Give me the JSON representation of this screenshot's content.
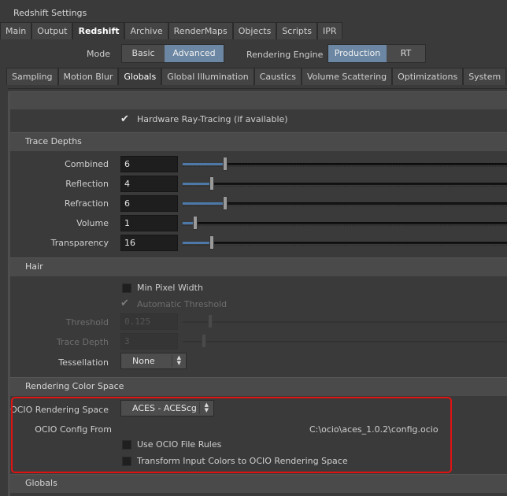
{
  "window": {
    "title": "Redshift Settings"
  },
  "top_tabs": [
    {
      "label": "Main"
    },
    {
      "label": "Output"
    },
    {
      "label": "Redshift"
    },
    {
      "label": "Archive"
    },
    {
      "label": "RenderMaps"
    },
    {
      "label": "Objects"
    },
    {
      "label": "Scripts"
    },
    {
      "label": "IPR"
    }
  ],
  "mode": {
    "label": "Mode",
    "options": [
      "Basic",
      "Advanced"
    ],
    "selected": "Advanced"
  },
  "engine": {
    "label": "Rendering Engine",
    "options": [
      "Production",
      "RT"
    ],
    "selected": "Production"
  },
  "sub_tabs": [
    {
      "label": "Sampling"
    },
    {
      "label": "Motion Blur"
    },
    {
      "label": "Globals"
    },
    {
      "label": "Global Illumination"
    },
    {
      "label": "Caustics"
    },
    {
      "label": "Volume Scattering"
    },
    {
      "label": "Optimizations"
    },
    {
      "label": "System"
    }
  ],
  "hw_raytracing": {
    "label": "Hardware Ray-Tracing (if available)",
    "checked": true
  },
  "trace_depths": {
    "header": "Trace Depths",
    "rows": [
      {
        "label": "Combined",
        "value": "6",
        "level": 0.13
      },
      {
        "label": "Reflection",
        "value": "4",
        "level": 0.09
      },
      {
        "label": "Refraction",
        "value": "6",
        "level": 0.13
      },
      {
        "label": "Volume",
        "value": "1",
        "level": 0.04
      },
      {
        "label": "Transparency",
        "value": "16",
        "level": 0.09
      }
    ]
  },
  "hair": {
    "header": "Hair",
    "min_pixel_width": {
      "label": "Min Pixel Width",
      "checked": false
    },
    "auto_threshold": {
      "label": "Automatic Threshold",
      "checked": true
    },
    "threshold": {
      "label": "Threshold",
      "value": "0.125"
    },
    "trace_depth": {
      "label": "Trace Depth",
      "value": "3"
    },
    "tessellation": {
      "label": "Tessellation",
      "value": "None"
    }
  },
  "color_space": {
    "header": "Rendering Color Space",
    "ocio_space": {
      "label": "OCIO Rendering Space",
      "value": "ACES - ACEScg"
    },
    "ocio_config": {
      "label": "OCIO Config From",
      "value": "C:\\ocio\\aces_1.0.2\\config.ocio"
    },
    "use_file_rules": {
      "label": "Use OCIO File Rules",
      "checked": false
    },
    "transform_input": {
      "label": "Transform Input Colors to OCIO Rendering Space",
      "checked": false
    }
  },
  "globals_header": "Globals",
  "colors": {
    "accent": "#6c87a3",
    "highlight_box": "#e01313",
    "slider_fill": "#4d79a8"
  }
}
